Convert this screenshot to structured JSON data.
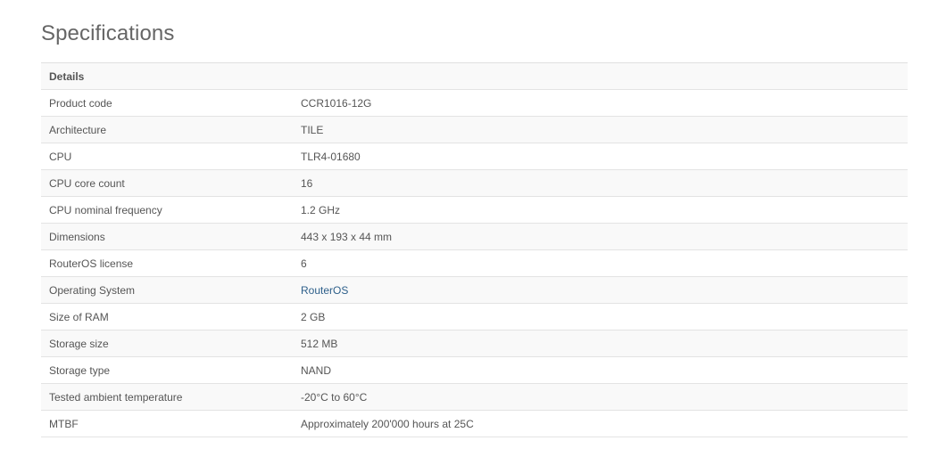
{
  "page": {
    "title": "Specifications"
  },
  "table": {
    "header": "Details",
    "rows": [
      {
        "label": "Product code",
        "value": "CCR1016-12G"
      },
      {
        "label": "Architecture",
        "value": "TILE"
      },
      {
        "label": "CPU",
        "value": "TLR4-01680"
      },
      {
        "label": "CPU core count",
        "value": "16"
      },
      {
        "label": "CPU nominal frequency",
        "value": "1.2 GHz"
      },
      {
        "label": "Dimensions",
        "value": "443 x 193 x 44 mm"
      },
      {
        "label": "RouterOS license",
        "value": "6"
      },
      {
        "label": "Operating System",
        "value": "RouterOS",
        "link": true
      },
      {
        "label": "Size of RAM",
        "value": "2 GB"
      },
      {
        "label": "Storage size",
        "value": "512 MB"
      },
      {
        "label": "Storage type",
        "value": "NAND"
      },
      {
        "label": "Tested ambient temperature",
        "value": "-20°C to 60°C"
      },
      {
        "label": "MTBF",
        "value": "Approximately 200'000 hours at 25C"
      }
    ]
  },
  "colors": {
    "link": "#2d5f8a",
    "stripe": "#f9f9f9",
    "border": "#e3e3e3"
  }
}
